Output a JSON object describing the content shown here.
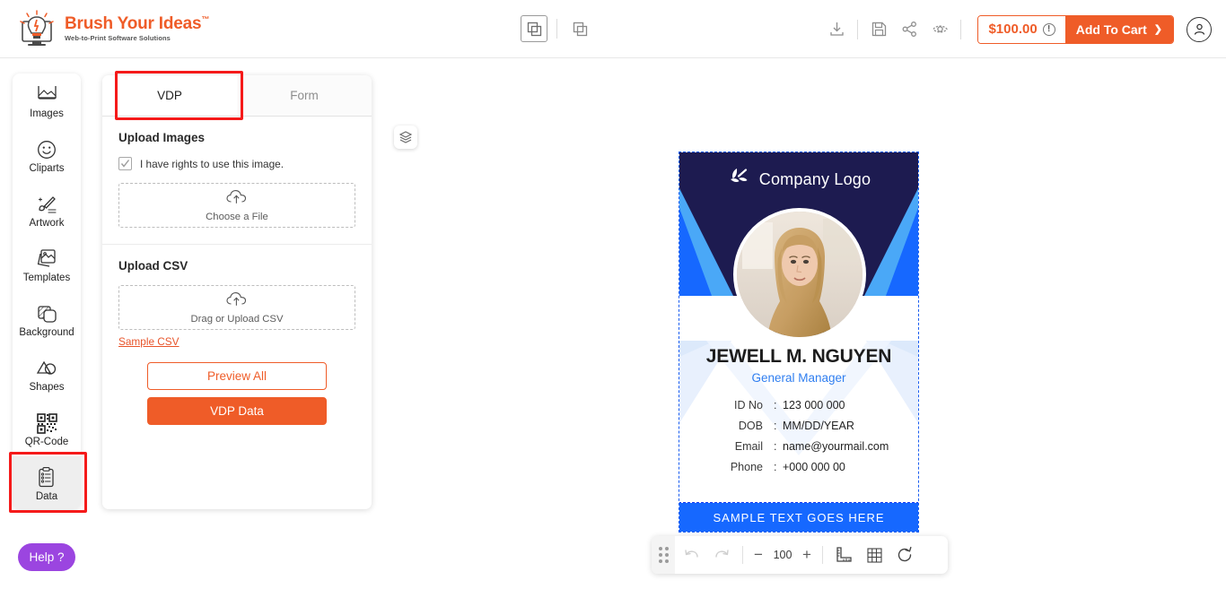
{
  "header": {
    "logo_title": "Brush Your Ideas",
    "logo_tm": "™",
    "logo_sub": "Web-to-Print Software Solutions",
    "center_icons": [
      {
        "name": "single-page-view-icon",
        "active": true
      },
      {
        "name": "double-page-view-icon",
        "active": false
      }
    ],
    "right_icons": [
      {
        "name": "download-icon"
      },
      {
        "name": "save-icon"
      },
      {
        "name": "share-icon"
      },
      {
        "name": "preview-eye-icon"
      }
    ],
    "price": "$100.00",
    "info_symbol": "!",
    "cart_label": "Add To Cart",
    "cart_arrow": "❯",
    "account_icon": "user-account-icon"
  },
  "sidebar": {
    "items": [
      {
        "label": "Images",
        "icon": "images-icon",
        "selected": false
      },
      {
        "label": "Cliparts",
        "icon": "smiley-cliparts-icon",
        "selected": false
      },
      {
        "label": "Artwork",
        "icon": "artwork-brush-icon",
        "selected": false
      },
      {
        "label": "Templates",
        "icon": "templates-icon",
        "selected": false
      },
      {
        "label": "Background",
        "icon": "background-layers-icon",
        "selected": false
      },
      {
        "label": "Shapes",
        "icon": "shapes-icon",
        "selected": false
      },
      {
        "label": "QR-Code",
        "icon": "qr-code-icon",
        "selected": false
      },
      {
        "label": "Data",
        "icon": "data-clipboard-icon",
        "selected": true
      }
    ]
  },
  "panel": {
    "tabs": [
      {
        "label": "VDP",
        "active": true
      },
      {
        "label": "Form",
        "active": false
      }
    ],
    "upload_images": {
      "title": "Upload Images",
      "checkbox_label": "I have rights to use this image.",
      "checkbox_checked": true,
      "dropzone_text": "Choose a File",
      "dropzone_icon": "cloud-upload-icon"
    },
    "upload_csv": {
      "title": "Upload CSV",
      "dropzone_text": "Drag or Upload CSV",
      "dropzone_icon": "cloud-upload-icon",
      "sample_link": "Sample CSV"
    },
    "buttons": {
      "preview_all": "Preview All",
      "vdp_data": "VDP Data"
    }
  },
  "canvas": {
    "layers_icon": "layers-icon",
    "card": {
      "company_logo_text": "Company Logo",
      "logo_icon": "leaf-logo-icon",
      "photo_alt": "portrait-photo",
      "name": "JEWELL M. NGUYEN",
      "role": "General Manager",
      "fields": [
        {
          "label": "ID No",
          "separator": ":",
          "value": "123 000 000"
        },
        {
          "label": "DOB",
          "separator": ":",
          "value": "MM/DD/YEAR"
        },
        {
          "label": "Email",
          "separator": ":",
          "value": "name@yourmail.com"
        },
        {
          "label": "Phone",
          "separator": ":",
          "value": "+000 000 00"
        }
      ],
      "footer_text": "SAMPLE  TEXT  GOES  HERE"
    }
  },
  "bottom_toolbar": {
    "handle_icon": "drag-handle-icon",
    "undo_icon": "undo-icon",
    "redo_icon": "redo-icon",
    "zoom_out": "−",
    "zoom_value": "100",
    "zoom_in": "+",
    "ruler_icon": "ruler-icon",
    "grid_icon": "grid-icon",
    "reset_icon": "reset-rotate-icon"
  },
  "help": {
    "label": "Help ?"
  },
  "colors": {
    "brand_orange": "#ef5c28",
    "annotation_red": "#f51a1a",
    "card_navy": "#1d1b50",
    "card_blue": "#1668ff",
    "role_blue": "#2f7ef0",
    "help_purple": "#9b45e0"
  }
}
